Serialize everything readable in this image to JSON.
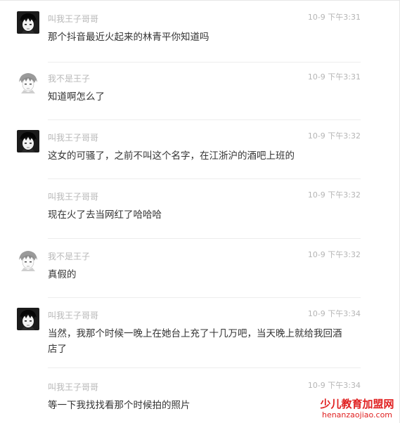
{
  "messages": [
    {
      "sender": "叫我王子哥哥",
      "time": "10-9 下午3:31",
      "text": "那个抖音最近火起来的林青平你知道吗",
      "avatar": "dark-avatar"
    },
    {
      "sender": "我不是王子",
      "time": "10-9 下午3:31",
      "text": "知道啊怎么了",
      "avatar": "light-avatar"
    },
    {
      "sender": "叫我王子哥哥",
      "time": "10-9 下午3:32",
      "text": "这女的可骚了，之前不叫这个名字，在江浙沪的酒吧上班的",
      "avatar": "dark-avatar"
    },
    {
      "sender": "叫我王子哥哥",
      "time": "10-9 下午3:32",
      "text": "现在火了去当网红了哈哈哈",
      "avatar": "none"
    },
    {
      "sender": "我不是王子",
      "time": "10-9 下午3:32",
      "text": "真假的",
      "avatar": "light-avatar"
    },
    {
      "sender": "叫我王子哥哥",
      "time": "10-9 下午3:34",
      "text": "当然，我那个时候一晚上在她台上充了十几万吧，当天晚上就给我回酒店了",
      "avatar": "dark-avatar"
    },
    {
      "sender": "叫我王子哥哥",
      "time": "10-9 下午3:34",
      "text": "等一下我找找看那个时候拍的照片",
      "avatar": "none"
    }
  ],
  "watermark": {
    "name": "少儿教育加盟网",
    "url": "henanzaojiao.com"
  },
  "colors": {
    "sender": "#b8b8b8",
    "time": "#b5b5b5",
    "text": "#333333",
    "watermark": "#e02020"
  }
}
